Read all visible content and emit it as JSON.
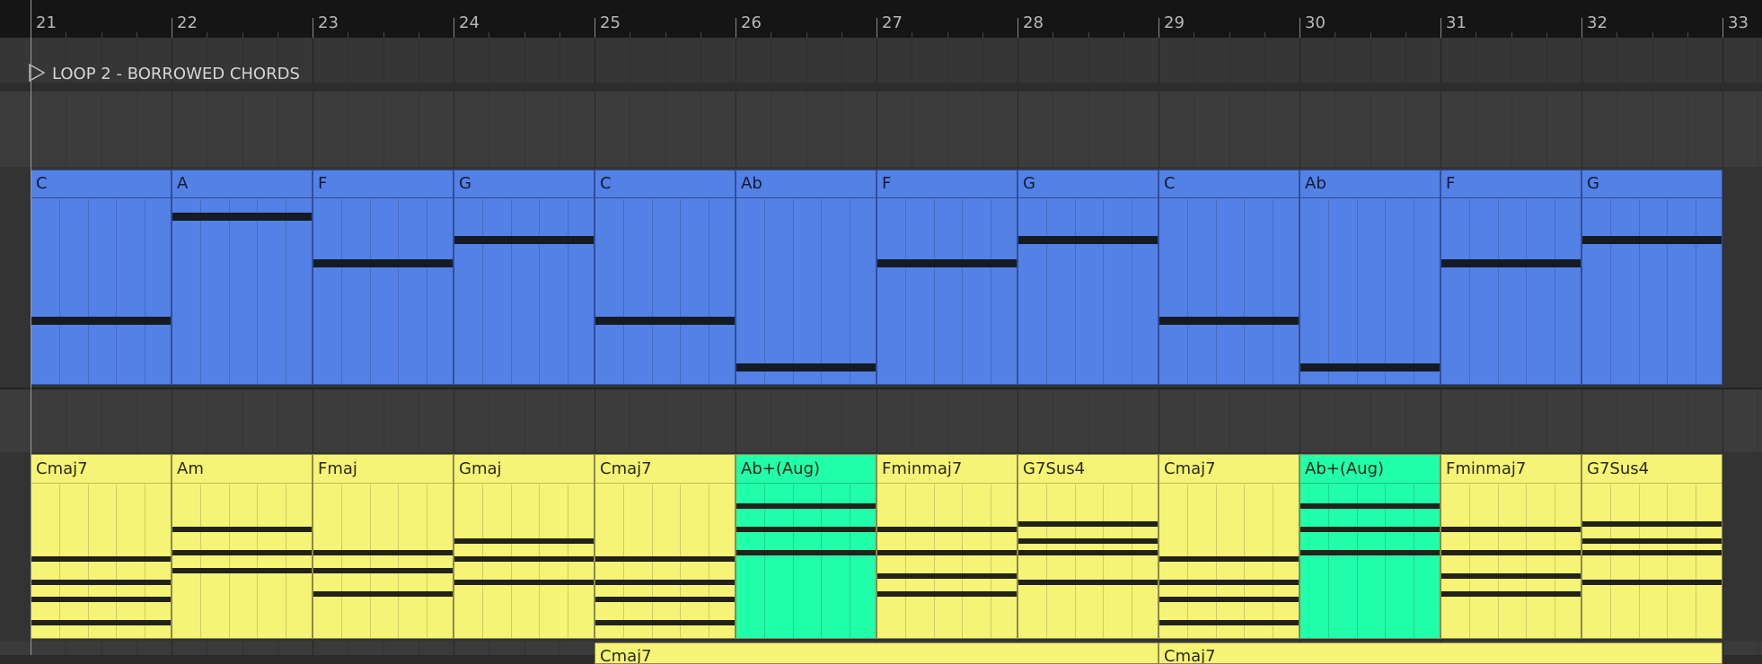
{
  "timeline": {
    "bars": [
      "21",
      "22",
      "23",
      "24",
      "25",
      "26",
      "27",
      "28",
      "29",
      "30",
      "31",
      "32",
      "33"
    ]
  },
  "locator": {
    "label": "LOOP 2 - BORROWED CHORDS",
    "icon": "play-triangle-icon"
  },
  "tracks": {
    "bass": {
      "color": "#5481e6",
      "clips": [
        {
          "name": "C",
          "pitches": [
            48
          ]
        },
        {
          "name": "A",
          "pitches": [
            57
          ]
        },
        {
          "name": "F",
          "pitches": [
            53
          ]
        },
        {
          "name": "G",
          "pitches": [
            55
          ]
        },
        {
          "name": "C",
          "pitches": [
            48
          ]
        },
        {
          "name": "Ab",
          "pitches": [
            44
          ]
        },
        {
          "name": "F",
          "pitches": [
            53
          ]
        },
        {
          "name": "G",
          "pitches": [
            55
          ]
        },
        {
          "name": "C",
          "pitches": [
            48
          ]
        },
        {
          "name": "Ab",
          "pitches": [
            44
          ]
        },
        {
          "name": "F",
          "pitches": [
            53
          ]
        },
        {
          "name": "G",
          "pitches": [
            55
          ]
        }
      ]
    },
    "chords": {
      "color": "#f6f476",
      "highlight_color": "#22ffab",
      "clips": [
        {
          "name": "Cmaj7",
          "highlight": false,
          "pitches": [
            60,
            64,
            67,
            71
          ]
        },
        {
          "name": "Am",
          "highlight": false,
          "pitches": [
            69,
            72,
            76
          ]
        },
        {
          "name": "Fmaj",
          "highlight": false,
          "pitches": [
            65,
            69,
            72
          ]
        },
        {
          "name": "Gmaj",
          "highlight": false,
          "pitches": [
            67,
            71,
            74
          ]
        },
        {
          "name": "Cmaj7",
          "highlight": false,
          "pitches": [
            60,
            64,
            67,
            71
          ]
        },
        {
          "name": "Ab+(Aug)",
          "highlight": true,
          "pitches": [
            72,
            76,
            80
          ]
        },
        {
          "name": "Fminmaj7",
          "highlight": false,
          "pitches": [
            65,
            68,
            72,
            76
          ]
        },
        {
          "name": "G7Sus4",
          "highlight": false,
          "pitches": [
            67,
            72,
            74,
            77
          ]
        },
        {
          "name": "Cmaj7",
          "highlight": false,
          "pitches": [
            60,
            64,
            67,
            71
          ]
        },
        {
          "name": "Ab+(Aug)",
          "highlight": true,
          "pitches": [
            72,
            76,
            80
          ]
        },
        {
          "name": "Fminmaj7",
          "highlight": false,
          "pitches": [
            65,
            68,
            72,
            76
          ]
        },
        {
          "name": "G7Sus4",
          "highlight": false,
          "pitches": [
            67,
            72,
            74,
            77
          ]
        }
      ]
    },
    "next": {
      "clips": [
        {
          "name": "Cmaj7"
        },
        {
          "name": "Cmaj7"
        }
      ]
    }
  }
}
